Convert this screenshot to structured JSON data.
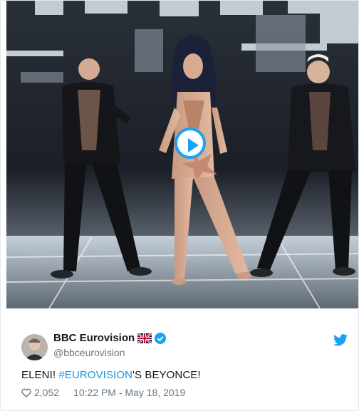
{
  "tweet": {
    "display_name": "BBC Eurovision",
    "handle": "@bbceurovision",
    "text_prefix": "ELENI! ",
    "hashtag": "#EUROVISION",
    "text_suffix": "'S BEYONCE!",
    "likes": "2,052",
    "timestamp": "10:22 PM - May 18, 2019"
  },
  "icons": {
    "flag": "uk-flag-icon",
    "verified": "verified-badge-icon",
    "twitter": "twitter-bird-icon",
    "like": "heart-icon",
    "video": "play-button-icon"
  },
  "colors": {
    "accent": "#1da1f2",
    "hashtag": "#1b95e0",
    "muted": "#657786",
    "text": "#14171a"
  }
}
